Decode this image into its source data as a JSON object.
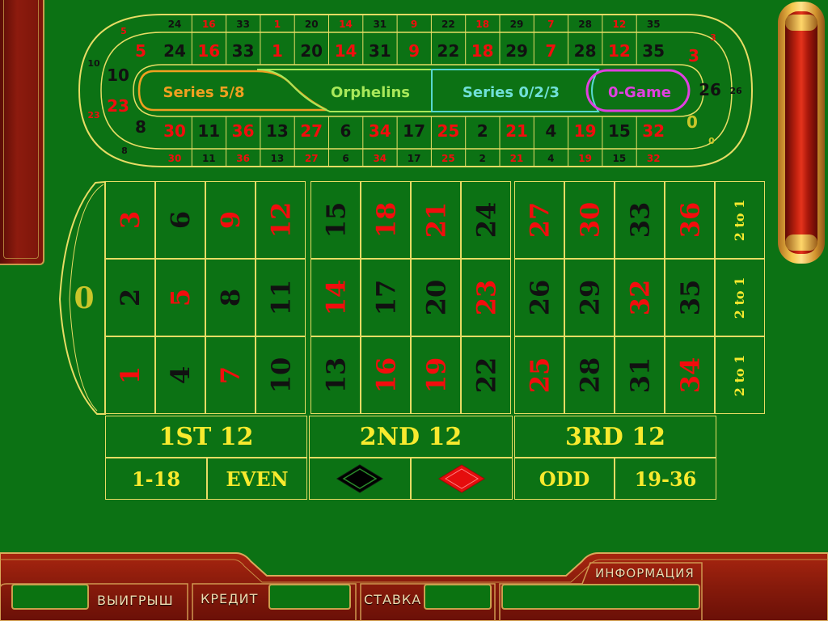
{
  "racetrack": {
    "top_outer": [
      "24",
      "16",
      "33",
      "1",
      "20",
      "14",
      "31",
      "9",
      "22",
      "18",
      "29",
      "7",
      "28",
      "12",
      "35"
    ],
    "top_inner": [
      "24",
      "16",
      "33",
      "1",
      "20",
      "14",
      "31",
      "9",
      "22",
      "18",
      "29",
      "7",
      "28",
      "12",
      "35"
    ],
    "bottom_inner": [
      "30",
      "11",
      "36",
      "13",
      "27",
      "6",
      "34",
      "17",
      "25",
      "2",
      "21",
      "4",
      "19",
      "15",
      "32"
    ],
    "bottom_outer": [
      "30",
      "11",
      "36",
      "13",
      "27",
      "6",
      "34",
      "17",
      "25",
      "2",
      "21",
      "4",
      "19",
      "15",
      "32"
    ],
    "left_inner": [
      "5",
      "10",
      "23",
      "8"
    ],
    "left_outer": [
      "5",
      "10",
      "23",
      "8"
    ],
    "right_inner": [
      "3",
      "26",
      "0"
    ],
    "right_outer": [
      "3",
      "26",
      "0"
    ],
    "sectors": {
      "series58": "Series 5/8",
      "orphelins": "Orphelins",
      "series023": "Series 0/2/3",
      "zero_game": "0-Game"
    }
  },
  "table": {
    "zero": "0",
    "col_bets": [
      "2 to 1",
      "2 to 1",
      "2 to 1"
    ],
    "dozens": [
      "1ST 12",
      "2ND 12",
      "3RD 12"
    ],
    "outside": {
      "low": "1-18",
      "even": "EVEN",
      "odd": "ODD",
      "high": "19-36"
    }
  },
  "bottom_panel": {
    "win_label": "ВЫИГРЫШ",
    "credit_label": "КРЕДИТ",
    "bet_label": "СТАВКА",
    "info_label": "ИНФОРМАЦИЯ"
  },
  "colors": {
    "felt": "#0c7214",
    "line": "#e7dc64",
    "red": "#f20d0d",
    "black": "#111111",
    "wood": "#8a1a0c"
  }
}
